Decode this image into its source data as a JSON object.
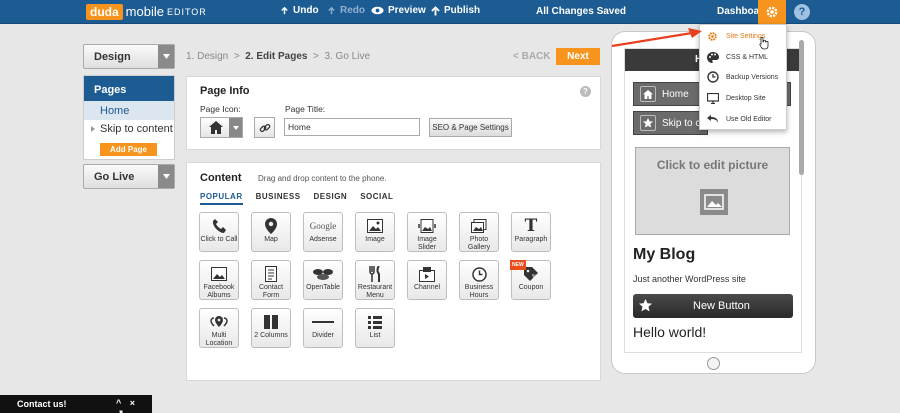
{
  "app": {
    "logo_brand": "duda",
    "logo_product": "mobile",
    "logo_suffix": "EDITOR"
  },
  "toolbar": {
    "undo": "Undo",
    "redo": "Redo",
    "preview": "Preview",
    "publish": "Publish",
    "status": "All Changes Saved",
    "dashboard": "Dashboard",
    "help": "?"
  },
  "sidebar": {
    "design": "Design",
    "pages_title": "Pages",
    "pages": [
      "Home",
      "Skip to content"
    ],
    "add_page": "Add Page",
    "go_live": "Go Live"
  },
  "steps": {
    "step1": "1. Design",
    "sep1": ">",
    "step2": "2. Edit Pages",
    "sep2": ">",
    "step3": "3. Go Live",
    "back": "< BACK",
    "next": "Next"
  },
  "page_info": {
    "title": "Page Info",
    "help": "?",
    "icon_label": "Page Icon:",
    "title_label": "Page Title:",
    "title_value": "Home",
    "seo_button": "SEO & Page Settings"
  },
  "content": {
    "title": "Content",
    "hint": "Drag and drop content to the phone.",
    "tabs": [
      "POPULAR",
      "BUSINESS",
      "DESIGN",
      "SOCIAL"
    ],
    "widgets": [
      {
        "label": "Click to Call",
        "icon": "phone-icon"
      },
      {
        "label": "Map",
        "icon": "map-pin-icon"
      },
      {
        "label": "Adsense",
        "icon": "google-icon",
        "logo_text": "Google"
      },
      {
        "label": "Image",
        "icon": "image-icon"
      },
      {
        "label": "Image Slider",
        "icon": "image-slider-icon"
      },
      {
        "label": "Photo Gallery",
        "icon": "photo-gallery-icon"
      },
      {
        "label": "Paragraph",
        "icon": "paragraph-icon",
        "glyph": "T"
      },
      {
        "label": "Facebook Albums",
        "icon": "facebook-albums-icon"
      },
      {
        "label": "Contact Form",
        "icon": "contact-form-icon"
      },
      {
        "label": "OpenTable",
        "icon": "opentable-icon"
      },
      {
        "label": "Restaurant Menu",
        "icon": "restaurant-menu-icon"
      },
      {
        "label": "Channel",
        "icon": "youtube-channel-icon"
      },
      {
        "label": "Business Hours",
        "icon": "clock-icon"
      },
      {
        "label": "Coupon",
        "icon": "coupon-icon",
        "badge": "NEW"
      },
      {
        "label": "Multi Location",
        "icon": "multi-location-icon"
      },
      {
        "label": "2 Columns",
        "icon": "columns-icon"
      },
      {
        "label": "Divider",
        "icon": "divider-icon"
      },
      {
        "label": "List",
        "icon": "list-icon"
      }
    ]
  },
  "phone": {
    "header_text": "H",
    "buttons": [
      "Home",
      "Skip to co"
    ],
    "picture_text": "Click to edit picture",
    "blog_title": "My Blog",
    "tagline": "Just another WordPress site",
    "new_button": "New Button",
    "post_title": "Hello world!"
  },
  "settings_menu": {
    "items": [
      {
        "label": "Site Settings",
        "icon": "gear-icon",
        "highlighted": true
      },
      {
        "label": "CSS & HTML",
        "icon": "palette-icon"
      },
      {
        "label": "Backup Versions",
        "icon": "history-icon"
      },
      {
        "label": "Desktop Site",
        "icon": "monitor-icon"
      },
      {
        "label": "Use Old Editor",
        "icon": "undo-icon"
      }
    ]
  },
  "contact": {
    "label": "Contact us!",
    "minimize": "^",
    "close": "×",
    "expand": "↗"
  },
  "colors": {
    "brand_blue": "#1d5b93",
    "accent_orange": "#f7941d",
    "arrow_red": "#e8401f"
  }
}
